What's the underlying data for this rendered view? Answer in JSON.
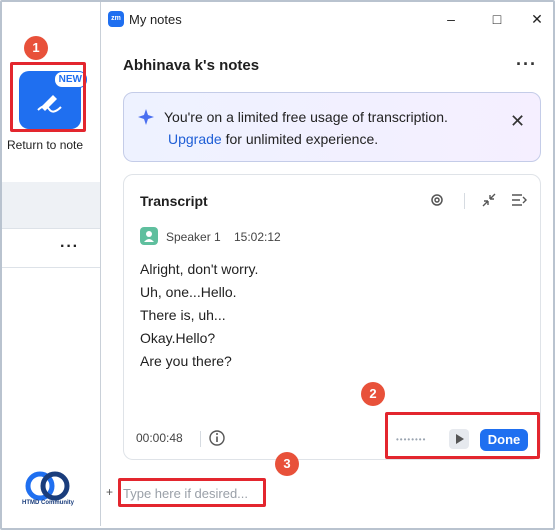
{
  "background_app": {
    "note_badge": "NEW",
    "return_label": "Return to note",
    "more_label": "···",
    "logo_text": "HTMD Community"
  },
  "window": {
    "app_icon_text": "zm",
    "title": "My notes"
  },
  "notes": {
    "owner_title": "Abhinava k's notes",
    "more_label": "···"
  },
  "banner": {
    "line1": "You're on a limited free usage of transcription.",
    "upgrade_link": "Upgrade",
    "line2_rest": " for unlimited experience."
  },
  "transcript": {
    "title": "Transcript",
    "speaker": "Speaker 1",
    "time": "15:02:12",
    "lines": [
      "Alright, don't worry.",
      "Uh, one...Hello.",
      "There is, uh...",
      "Okay.Hello?",
      "Are you there?"
    ],
    "elapsed": "00:00:48",
    "done_label": "Done"
  },
  "composer": {
    "placeholder": "Type here if desired..."
  },
  "annotations": {
    "step1": "1",
    "step2": "2",
    "step3": "3",
    "highlight_color": "#e3262e",
    "step_color": "#e8513a"
  },
  "colors": {
    "accent": "#1f6ff0",
    "link": "#1f5fd6",
    "speaker_avatar": "#5fbf9e"
  }
}
